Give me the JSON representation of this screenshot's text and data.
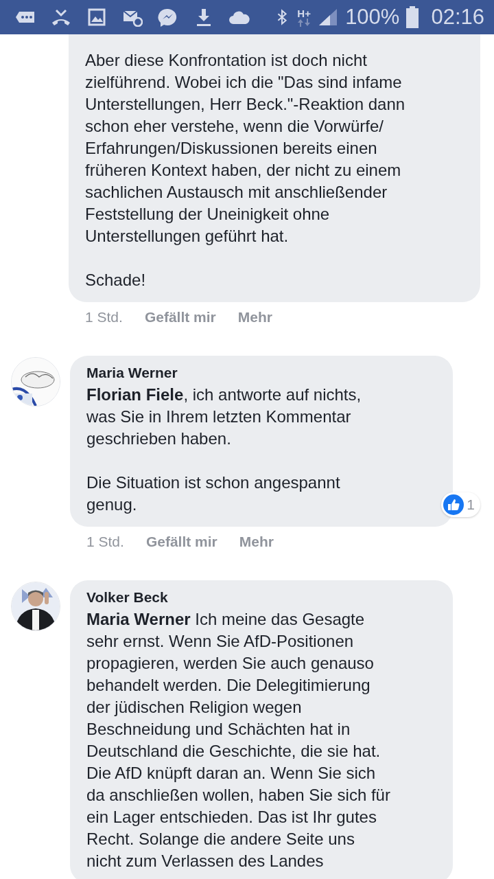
{
  "status_bar": {
    "network": "H+",
    "battery": "100%",
    "time": "02:16"
  },
  "comments": [
    {
      "cut_top": true,
      "text": "Aber diese Konfrontation ist doch nicht\nzielführend. Wobei ich die \"Das sind infame\nUnterstellungen, Herr Beck.\"-Reaktion dann\nschon eher verstehe, wenn die Vorwürfe/\nErfahrungen/Diskussionen bereits einen\nfrüheren Kontext haben, der nicht zu einem\nsachlichen Austausch mit anschließender\nFeststellung der Uneinigkeit ohne\nUnterstellungen geführt hat.\n\nSchade!",
      "time": "1 Std.",
      "actions": [
        "Gefällt mir",
        "Mehr"
      ]
    },
    {
      "avatar": {
        "kind": "picture"
      },
      "author": "Maria Werner",
      "text": "**Florian Fiele**, ich antworte auf nichts,\nwas Sie in Ihrem letzten Kommentar\ngeschrieben haben.\n\nDie Situation ist schon angespannt\ngenug.",
      "reaction": {
        "count": "1"
      },
      "time": "1 Std.",
      "actions": [
        "Gefällt mir",
        "Mehr"
      ]
    },
    {
      "avatar": {
        "kind": "picture"
      },
      "author": "Volker Beck",
      "text": "**Maria Werner** Ich meine das Gesagte\nsehr ernst. Wenn Sie AfD-Positionen\npropagieren, werden Sie auch genauso\nbehandelt werden. Die Delegitimierung\nder jüdischen Religion wegen\nBeschneidung und Schächten hat in\nDeutschland die Geschichte, die sie hat.\nDie AfD knüpft daran an. Wenn Sie sich\nda anschließen wollen, haben Sie sich für\nein Lager entschieden. Das ist Ihr gutes\nRecht. Solange die andere Seite uns\nnicht zum Verlassen des Landes"
    }
  ]
}
